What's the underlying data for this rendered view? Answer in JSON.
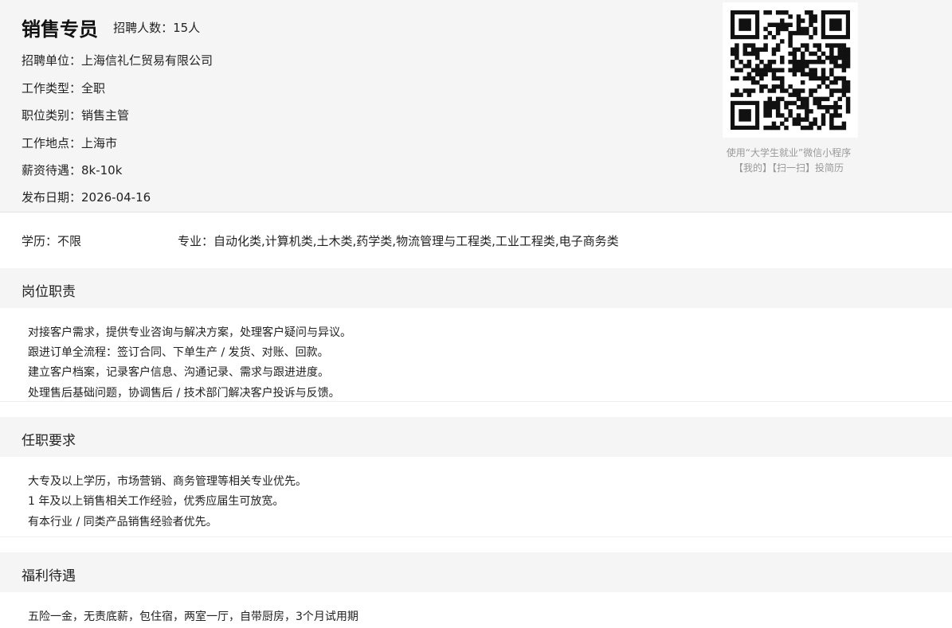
{
  "job": {
    "title": "销售专员",
    "headcount": "招聘人数：15人",
    "company": "招聘单位：上海信礼仁贸易有限公司",
    "type": "工作类型：全职",
    "category": "职位类别：销售主管",
    "location": "工作地点：上海市",
    "salary": "薪资待遇：8k-10k",
    "date": "发布日期：2026-04-16"
  },
  "qr": {
    "icon": "qr-code-icon",
    "caption_line1": "使用“大学生就业”微信小程序",
    "caption_line2": "【我的】【扫一扫】投简历"
  },
  "requirements": {
    "education": "学历：不限",
    "major": "专业：自动化类,计算机类,土木类,药学类,物流管理与工程类,工业工程类,电子商务类"
  },
  "sections": {
    "duties": {
      "heading": "岗位职责",
      "lines": [
        "对接客户需求，提供专业咨询与解决方案，处理客户疑问与异议。",
        "跟进订单全流程：签订合同、下单生产 / 发货、对账、回款。",
        "建立客户档案，记录客户信息、沟通记录、需求与跟进进度。",
        "处理售后基础问题，协调售后 / 技术部门解决客户投诉与反馈。"
      ]
    },
    "qualifications": {
      "heading": "任职要求",
      "lines": [
        "大专及以上学历，市场营销、商务管理等相关专业优先。",
        "1 年及以上销售相关工作经验，优秀应届生可放宽。",
        "有本行业 / 同类产品销售经验者优先。"
      ]
    },
    "benefits": {
      "heading": "福利待遇",
      "lines": [
        "五险一金，无责底薪，包住宿，两室一厅，自带厨房，3个月试用期"
      ]
    }
  }
}
